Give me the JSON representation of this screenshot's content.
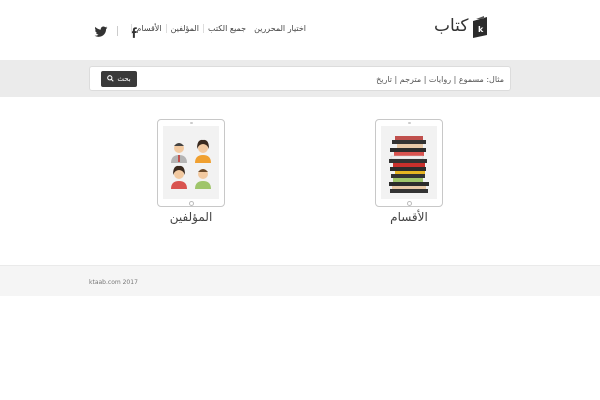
{
  "header": {
    "logo_text": "كتاب",
    "logo_letter": "k",
    "nav": [
      {
        "label": "الأقسام"
      },
      {
        "label": "المؤلفين"
      },
      {
        "label": "جميع الكتب"
      },
      {
        "label": "اختيار المحررين"
      }
    ],
    "social": [
      {
        "icon": "facebook-icon"
      },
      {
        "icon": "twitter-icon"
      }
    ]
  },
  "search": {
    "placeholder": "مثال: مسموع | روايات | مترجم | تاريخ",
    "button_label": "بحث",
    "button_icon": "search-icon"
  },
  "cards": {
    "sections": {
      "label": "الأقسام",
      "icon": "books-stack-icon"
    },
    "authors": {
      "label": "المؤلفين",
      "icon": "people-icon"
    }
  },
  "footer": {
    "copyright": "ktaab.com 2017"
  },
  "colors": {
    "band": "#ebebeb",
    "button": "#3a3a3a",
    "footer": "#f5f5f5"
  }
}
